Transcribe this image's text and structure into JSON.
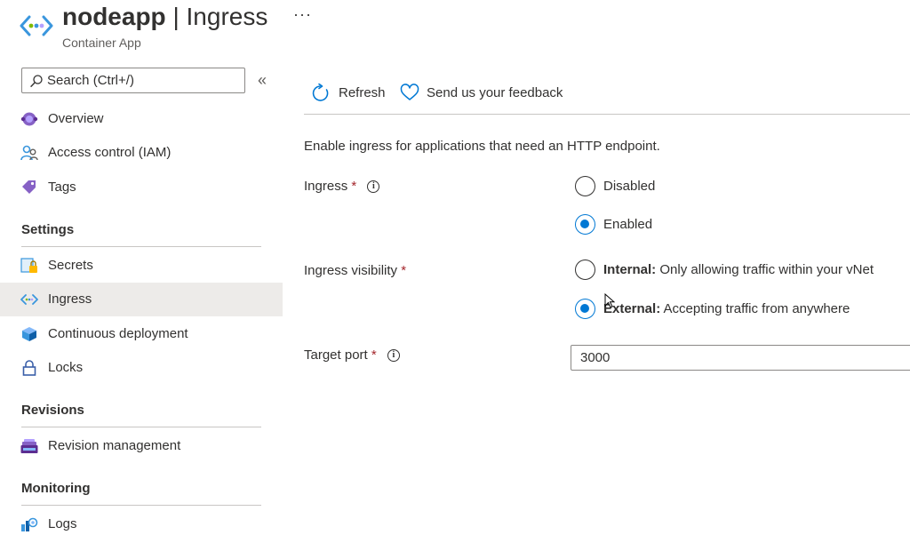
{
  "header": {
    "app_name": "nodeapp",
    "separator": "|",
    "page": "Ingress",
    "subtitle": "Container App",
    "more": "···",
    "icon": "container-app-icon"
  },
  "sidebar": {
    "search_placeholder": "Search (Ctrl+/)",
    "collapse": "«",
    "items_top": [
      {
        "label": "Overview",
        "icon": "overview-icon"
      },
      {
        "label": "Access control (IAM)",
        "icon": "iam-people-icon"
      },
      {
        "label": "Tags",
        "icon": "tag-icon"
      }
    ],
    "sections": [
      {
        "title": "Settings",
        "items": [
          {
            "label": "Secrets",
            "icon": "secrets-icon"
          },
          {
            "label": "Ingress",
            "icon": "ingress-icon",
            "selected": true
          },
          {
            "label": "Continuous deployment",
            "icon": "cube-icon"
          },
          {
            "label": "Locks",
            "icon": "lock-icon"
          }
        ]
      },
      {
        "title": "Revisions",
        "items": [
          {
            "label": "Revision management",
            "icon": "revision-icon"
          }
        ]
      },
      {
        "title": "Monitoring",
        "items": [
          {
            "label": "Logs",
            "icon": "logs-icon"
          }
        ]
      }
    ]
  },
  "toolbar": {
    "refresh": "Refresh",
    "feedback": "Send us your feedback"
  },
  "form": {
    "description": "Enable ingress for applications that need an HTTP endpoint.",
    "required_mark": "*",
    "info_glyph": "i",
    "ingress": {
      "label": "Ingress",
      "options": [
        {
          "label": "Disabled",
          "checked": false
        },
        {
          "label": "Enabled",
          "checked": true
        }
      ]
    },
    "visibility": {
      "label": "Ingress visibility",
      "options": [
        {
          "bold": "Internal:",
          "text": " Only allowing traffic within your vNet",
          "checked": false
        },
        {
          "bold": "External:",
          "text": " Accepting traffic from anywhere",
          "checked": true
        }
      ]
    },
    "target_port": {
      "label": "Target port",
      "value": "3000"
    }
  },
  "colors": {
    "accent": "#0078d4",
    "required": "#a4262c",
    "selected_bg": "#edebe9"
  }
}
